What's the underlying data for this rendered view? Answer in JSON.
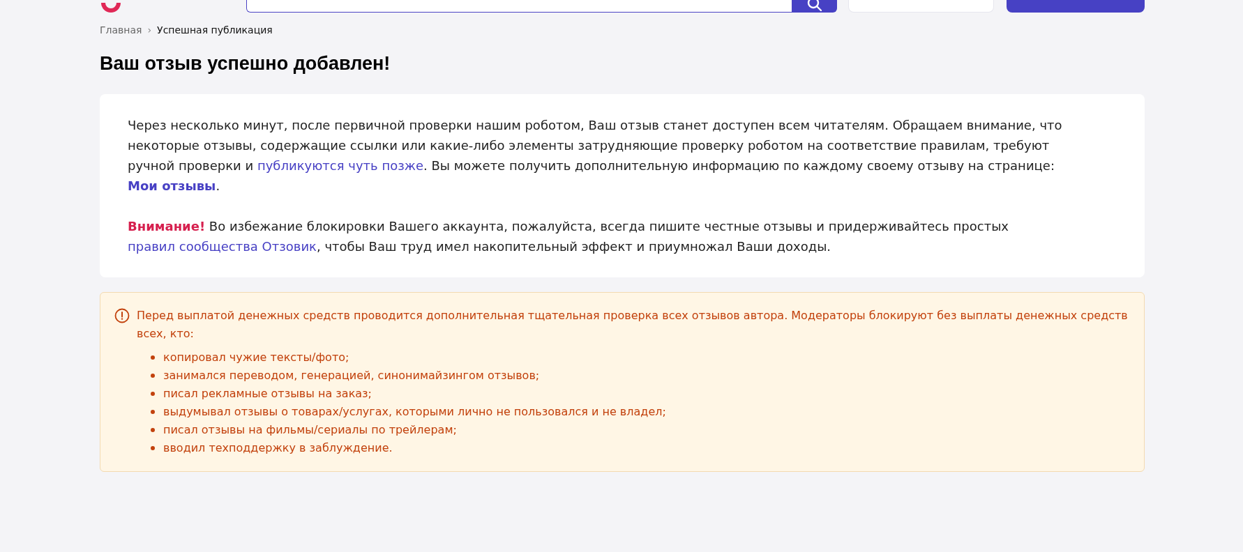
{
  "breadcrumb_separator": "›",
  "breadcrumbs": [
    {
      "label": "Главная",
      "current": false
    },
    {
      "label": "Успешная публикация",
      "current": true
    }
  ],
  "title": "Ваш отзыв успешно добавлен!",
  "message": {
    "paragraphs": [
      [
        {
          "kind": "text",
          "text": "Через несколько минут, после первичной проверки нашим роботом, Ваш отзыв станет доступен всем читателям. Обращаем внимание, что некоторые отзывы, содержащие ссылки или какие-либо элементы затрудняющие проверку роботом на соответствие правилам, требуют ручной проверки и "
        },
        {
          "kind": "link",
          "text": "публикуются чуть позже"
        },
        {
          "kind": "text",
          "text": ". Вы можете получить дополнительную информацию по каждому своему отзыву на странице: "
        },
        {
          "kind": "strong-link",
          "text": "Мои отзывы"
        },
        {
          "kind": "text",
          "text": "."
        }
      ],
      [
        {
          "kind": "alert",
          "text": "Внимание!"
        },
        {
          "kind": "text",
          "text": " Во избежание блокировки Вашего аккаунта, пожалуйста, всегда пишите честные отзывы и придерживайтесь простых "
        },
        {
          "kind": "link",
          "text": "правил сообщества Отзовик"
        },
        {
          "kind": "text",
          "text": ", чтобы Ваш труд имел накопительный эффект и приумножал Ваши доходы."
        }
      ]
    ]
  },
  "notice": {
    "text": "Перед выплатой денежных средств проводится дополнительная тщательная проверка всех отзывов автора. Модераторы блокируют без выплаты денежных средств всех, кто:",
    "items": [
      "копировал чужие тексты/фото;",
      "занимался переводом, генерацией, синонимайзингом отзывов;",
      "писал рекламные отзывы на заказ;",
      "выдумывал отзывы о товарах/услугах, которыми лично не пользовался и не владел;",
      "писал отзывы на фильмы/сериалы по трейлерам;",
      "вводил техподдержку в заблуждение."
    ]
  }
}
